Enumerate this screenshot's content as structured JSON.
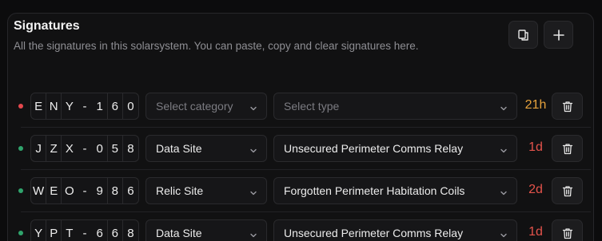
{
  "header": {
    "title": "Signatures",
    "subtitle": "All the signatures in this solarsystem. You can paste, copy and clear signatures here.",
    "copy_icon": "copy-icon",
    "add_icon": "plus-icon"
  },
  "colors": {
    "dot_red": "#e5484d",
    "dot_green": "#30a46c",
    "age_orange": "#f5a623",
    "age_red": "#e5484d"
  },
  "signatures": [
    {
      "status": "red",
      "chars": [
        "E",
        "N",
        "Y",
        "-",
        "1",
        "6",
        "0"
      ],
      "category": "Select category",
      "category_placeholder": true,
      "type": "Select type",
      "type_placeholder": true,
      "age": "21h",
      "age_color": "#e6a23c"
    },
    {
      "status": "green",
      "chars": [
        "J",
        "Z",
        "X",
        "-",
        "0",
        "5",
        "8"
      ],
      "category": "Data Site",
      "category_placeholder": false,
      "type": "Unsecured Perimeter Comms Relay",
      "type_placeholder": false,
      "age": "1d",
      "age_color": "#e5534b"
    },
    {
      "status": "green",
      "chars": [
        "W",
        "E",
        "O",
        "-",
        "9",
        "8",
        "6"
      ],
      "category": "Relic Site",
      "category_placeholder": false,
      "type": "Forgotten Perimeter Habitation Coils",
      "type_placeholder": false,
      "age": "2d",
      "age_color": "#e5534b"
    },
    {
      "status": "green",
      "chars": [
        "Y",
        "P",
        "T",
        "-",
        "6",
        "6",
        "8"
      ],
      "category": "Data Site",
      "category_placeholder": false,
      "type": "Unsecured Perimeter Comms Relay",
      "type_placeholder": false,
      "age": "1d",
      "age_color": "#e5534b"
    }
  ]
}
